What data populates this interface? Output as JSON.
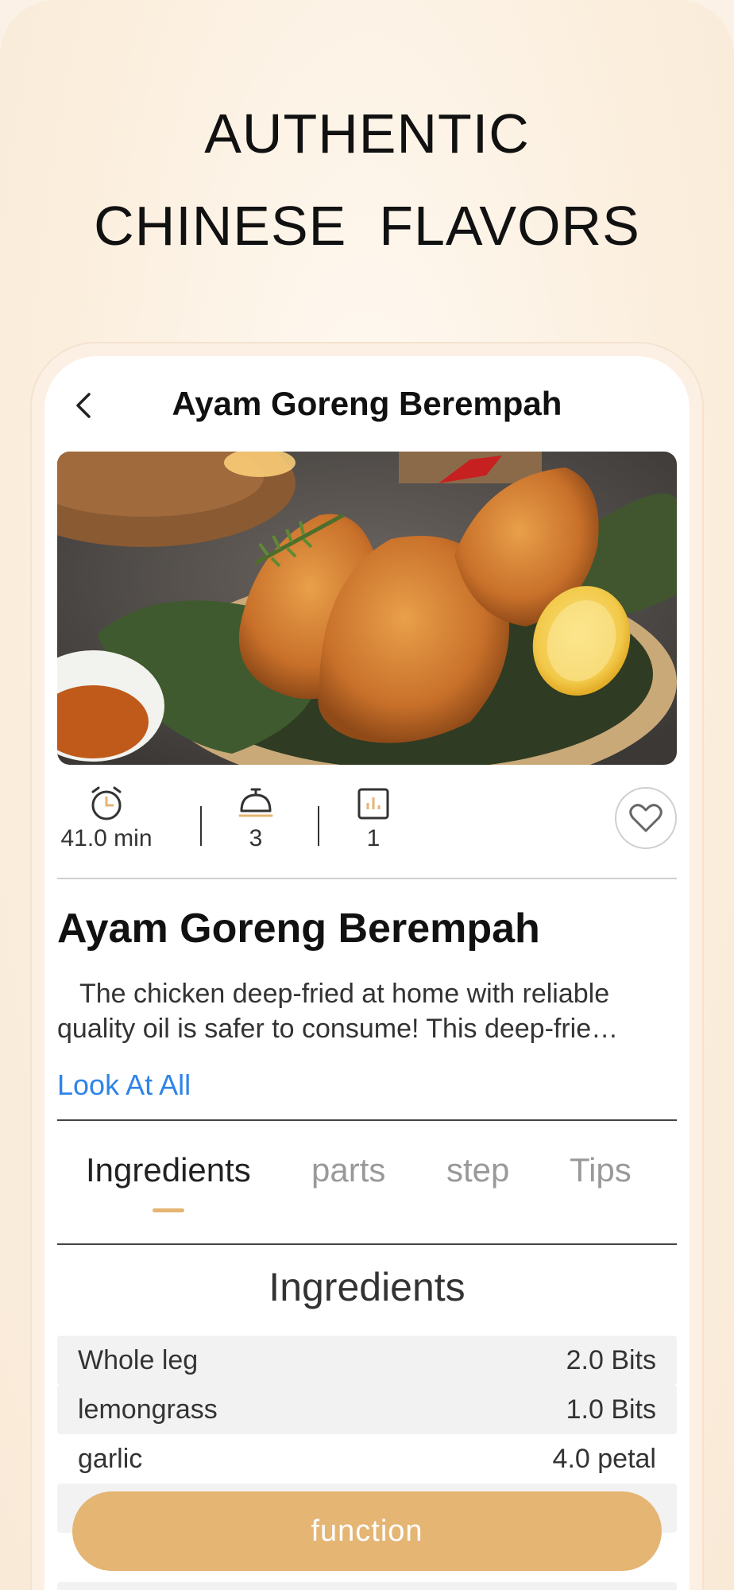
{
  "headline": {
    "line1": "AUTHENTIC",
    "line2": "CHINESE  FLAVORS"
  },
  "nav": {
    "title": "Ayam Goreng Berempah",
    "back_icon": "chevron-left-icon"
  },
  "stats": {
    "time": "41.0 min",
    "servings": "3",
    "difficulty": "1"
  },
  "recipe": {
    "title": "Ayam Goreng Berempah",
    "desc_line1": "The chicken deep-fried at home with reliable",
    "desc_line2": "quality oil is safer to consume! This deep-frie…",
    "look_all": "Look At All"
  },
  "tabs": [
    "Ingredients",
    "parts",
    "step",
    "Tips"
  ],
  "section_title": "Ingredients",
  "ingredients": [
    {
      "name": "Whole leg",
      "qty": "2.0 Bits"
    },
    {
      "name": "lemongrass",
      "qty": "1.0 Bits"
    },
    {
      "name": "garlic",
      "qty": "4.0 petal"
    }
  ],
  "cta": "function",
  "colors": {
    "accent": "#e5b574",
    "link": "#2e84e8"
  }
}
